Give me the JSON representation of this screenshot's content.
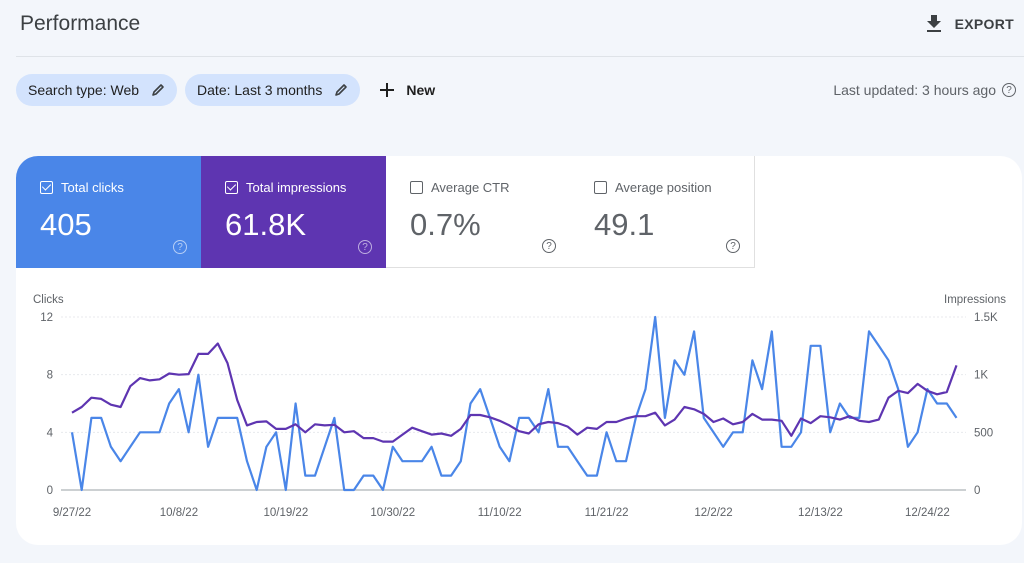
{
  "header": {
    "title": "Performance",
    "export_label": "EXPORT"
  },
  "filters": {
    "chips": [
      {
        "label": "Search type: Web"
      },
      {
        "label": "Date: Last 3 months"
      }
    ],
    "new_label": "New",
    "last_updated": "Last updated: 3 hours ago"
  },
  "metrics": [
    {
      "label": "Total clicks",
      "value": "405",
      "checked": true,
      "color": "#4a86e8"
    },
    {
      "label": "Total impressions",
      "value": "61.8K",
      "checked": true,
      "color": "#5e35b1"
    },
    {
      "label": "Average CTR",
      "value": "0.7%",
      "checked": false
    },
    {
      "label": "Average position",
      "value": "49.1",
      "checked": false
    }
  ],
  "chart_data": {
    "type": "line",
    "left_axis_label": "Clicks",
    "right_axis_label": "Impressions",
    "left_ticks": [
      "0",
      "4",
      "8",
      "12"
    ],
    "right_ticks": [
      "0",
      "500",
      "1K",
      "1.5K"
    ],
    "ylim_left": [
      0,
      12
    ],
    "ylim_right": [
      0,
      1500
    ],
    "grid": true,
    "x_tick_labels": [
      "9/27/22",
      "10/8/22",
      "10/19/22",
      "10/30/22",
      "11/10/22",
      "11/21/22",
      "12/2/22",
      "12/13/22",
      "12/24/22"
    ],
    "x_tick_every_days": 11,
    "x_start": "9/27/22",
    "series": [
      {
        "name": "Clicks",
        "axis": "left",
        "color": "#4a86e8",
        "values": [
          4,
          0,
          5,
          5,
          3,
          2,
          3,
          4,
          4,
          4,
          6,
          7,
          4,
          8,
          3,
          5,
          5,
          5,
          2,
          0,
          3,
          4,
          0,
          6,
          1,
          1,
          3,
          5,
          0,
          0,
          1,
          1,
          0,
          3,
          2,
          2,
          2,
          3,
          1,
          1,
          2,
          6,
          7,
          5,
          3,
          2,
          5,
          5,
          4,
          7,
          3,
          3,
          2,
          1,
          1,
          4,
          2,
          2,
          5,
          7,
          12,
          5,
          9,
          8,
          11,
          5,
          4,
          3,
          4,
          4,
          9,
          7,
          11,
          3,
          3,
          4,
          10,
          10,
          4,
          6,
          5,
          5,
          11,
          10,
          9,
          7,
          3,
          4,
          7,
          6,
          6,
          5
        ]
      },
      {
        "name": "Impressions",
        "axis": "right",
        "color": "#5e35b1",
        "values": [
          670,
          720,
          800,
          790,
          740,
          720,
          900,
          970,
          950,
          960,
          1010,
          1000,
          1005,
          1180,
          1180,
          1270,
          1100,
          780,
          560,
          590,
          595,
          530,
          530,
          570,
          500,
          570,
          560,
          565,
          500,
          510,
          450,
          450,
          420,
          420,
          480,
          540,
          510,
          480,
          490,
          470,
          530,
          650,
          650,
          630,
          600,
          560,
          510,
          490,
          570,
          590,
          580,
          550,
          480,
          540,
          530,
          590,
          590,
          620,
          640,
          640,
          670,
          560,
          610,
          720,
          700,
          660,
          590,
          620,
          570,
          590,
          660,
          610,
          610,
          600,
          470,
          620,
          580,
          640,
          630,
          610,
          640,
          600,
          590,
          610,
          800,
          860,
          840,
          920,
          860,
          830,
          850,
          1080
        ]
      }
    ]
  }
}
